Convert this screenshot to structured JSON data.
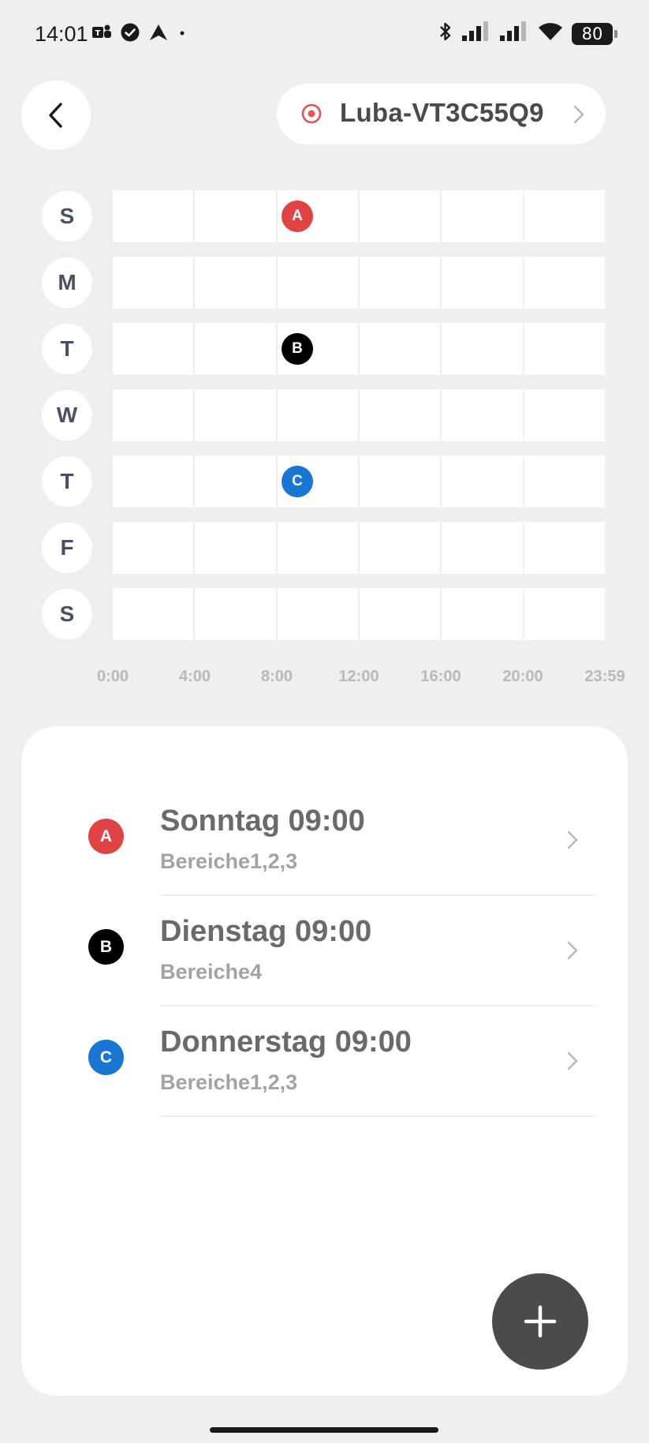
{
  "status_bar": {
    "time": "14:01",
    "battery": "80",
    "left_icons": [
      "teams-icon",
      "check-circle-icon",
      "arrow-up-icon",
      "dot-icon"
    ],
    "right_icons": [
      "bluetooth-icon",
      "signal-icon",
      "signal-icon",
      "wifi-icon"
    ]
  },
  "header": {
    "device_name": "Luba-VT3C55Q9",
    "device_icon_color": "#e05555"
  },
  "schedule": {
    "days": [
      "S",
      "M",
      "T",
      "W",
      "T",
      "F",
      "S"
    ],
    "time_labels": [
      "0:00",
      "4:00",
      "8:00",
      "12:00",
      "16:00",
      "20:00",
      "23:59"
    ],
    "markers": [
      {
        "label": "A",
        "day_index": 0,
        "hour": 9,
        "color": "#e04343"
      },
      {
        "label": "B",
        "day_index": 2,
        "hour": 9,
        "color": "#000000"
      },
      {
        "label": "C",
        "day_index": 4,
        "hour": 9,
        "color": "#1976d2"
      }
    ]
  },
  "tasks": [
    {
      "badge": "A",
      "title": "Sonntag 09:00",
      "subtitle": "Bereiche1,2,3",
      "color": "#e04343"
    },
    {
      "badge": "B",
      "title": "Dienstag 09:00",
      "subtitle": "Bereiche4",
      "color": "#000000"
    },
    {
      "badge": "C",
      "title": "Donnerstag 09:00",
      "subtitle": "Bereiche1,2,3",
      "color": "#1976d2"
    }
  ]
}
